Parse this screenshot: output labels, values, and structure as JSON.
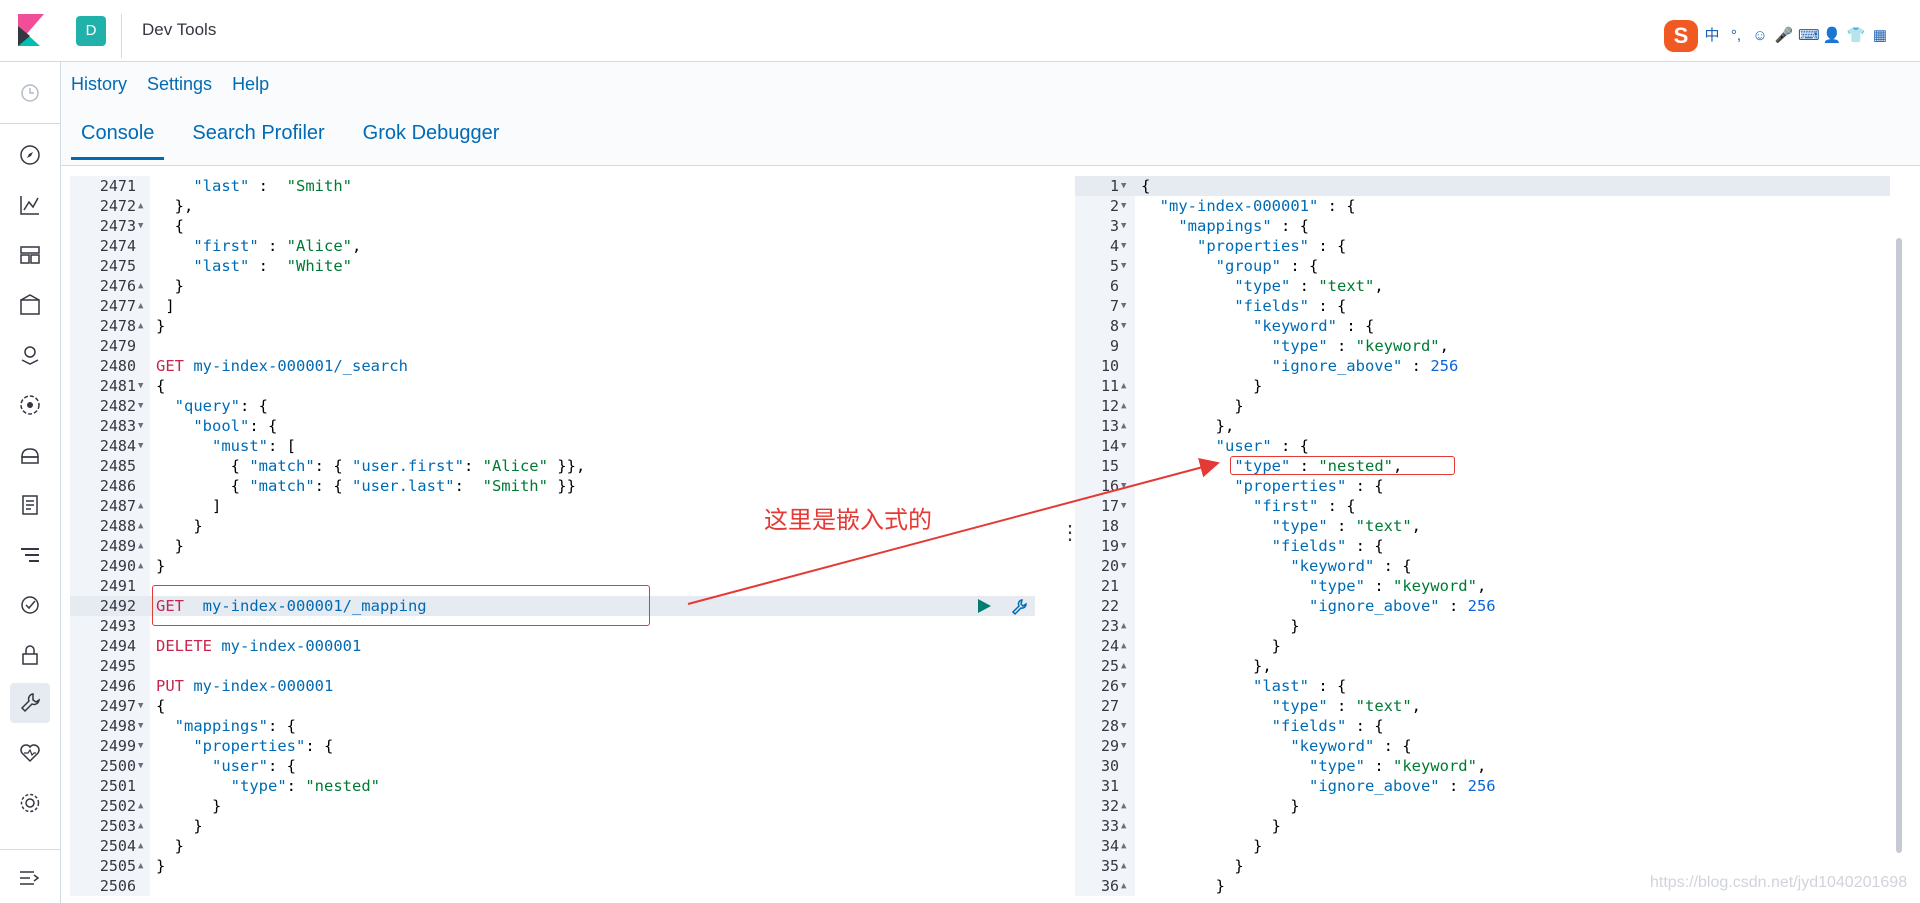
{
  "header": {
    "space_initial": "D",
    "app_title": "Dev Tools"
  },
  "ime_toolbar": [
    "S",
    "中",
    "°,",
    "☺",
    "🎤",
    "⌨",
    "👤",
    "👕",
    "▦"
  ],
  "menu": {
    "links": [
      "History",
      "Settings",
      "Help"
    ]
  },
  "tabs": [
    "Console",
    "Search Profiler",
    "Grok Debugger"
  ],
  "annotation": "这里是嵌入式的",
  "watermark": "https://blog.csdn.net/jyd1040201698",
  "request_lines": [
    {
      "n": "2471",
      "f": "",
      "t": "    \"last\" :  \"Smith\""
    },
    {
      "n": "2472",
      "f": "▲",
      "t": "  },"
    },
    {
      "n": "2473",
      "f": "▼",
      "t": "  {"
    },
    {
      "n": "2474",
      "f": "",
      "t": "    \"first\" : \"Alice\","
    },
    {
      "n": "2475",
      "f": "",
      "t": "    \"last\" :  \"White\""
    },
    {
      "n": "2476",
      "f": "▲",
      "t": "  }"
    },
    {
      "n": "2477",
      "f": "▲",
      "t": " ]"
    },
    {
      "n": "2478",
      "f": "▲",
      "t": "}"
    },
    {
      "n": "2479",
      "f": "",
      "t": ""
    },
    {
      "n": "2480",
      "f": "",
      "t": "GET my-index-000001/_search"
    },
    {
      "n": "2481",
      "f": "▼",
      "t": "{"
    },
    {
      "n": "2482",
      "f": "▼",
      "t": "  \"query\": {"
    },
    {
      "n": "2483",
      "f": "▼",
      "t": "    \"bool\": {"
    },
    {
      "n": "2484",
      "f": "▼",
      "t": "      \"must\": ["
    },
    {
      "n": "2485",
      "f": "",
      "t": "        { \"match\": { \"user.first\": \"Alice\" }},"
    },
    {
      "n": "2486",
      "f": "",
      "t": "        { \"match\": { \"user.last\":  \"Smith\" }}"
    },
    {
      "n": "2487",
      "f": "▲",
      "t": "      ]"
    },
    {
      "n": "2488",
      "f": "▲",
      "t": "    }"
    },
    {
      "n": "2489",
      "f": "▲",
      "t": "  }"
    },
    {
      "n": "2490",
      "f": "▲",
      "t": "}"
    },
    {
      "n": "2491",
      "f": "",
      "t": ""
    },
    {
      "n": "2492",
      "f": "",
      "t": "GET  my-index-000001/_mapping"
    },
    {
      "n": "2493",
      "f": "",
      "t": ""
    },
    {
      "n": "2494",
      "f": "",
      "t": "DELETE my-index-000001"
    },
    {
      "n": "2495",
      "f": "",
      "t": ""
    },
    {
      "n": "2496",
      "f": "",
      "t": "PUT my-index-000001"
    },
    {
      "n": "2497",
      "f": "▼",
      "t": "{"
    },
    {
      "n": "2498",
      "f": "▼",
      "t": "  \"mappings\": {"
    },
    {
      "n": "2499",
      "f": "▼",
      "t": "    \"properties\": {"
    },
    {
      "n": "2500",
      "f": "▼",
      "t": "      \"user\": {"
    },
    {
      "n": "2501",
      "f": "",
      "t": "        \"type\": \"nested\""
    },
    {
      "n": "2502",
      "f": "▲",
      "t": "      }"
    },
    {
      "n": "2503",
      "f": "▲",
      "t": "    }"
    },
    {
      "n": "2504",
      "f": "▲",
      "t": "  }"
    },
    {
      "n": "2505",
      "f": "▲",
      "t": "}"
    },
    {
      "n": "2506",
      "f": "",
      "t": ""
    }
  ],
  "response_lines": [
    {
      "n": "1",
      "f": "▼",
      "t": "{"
    },
    {
      "n": "2",
      "f": "▼",
      "t": "  \"my-index-000001\" : {"
    },
    {
      "n": "3",
      "f": "▼",
      "t": "    \"mappings\" : {"
    },
    {
      "n": "4",
      "f": "▼",
      "t": "      \"properties\" : {"
    },
    {
      "n": "5",
      "f": "▼",
      "t": "        \"group\" : {"
    },
    {
      "n": "6",
      "f": "",
      "t": "          \"type\" : \"text\","
    },
    {
      "n": "7",
      "f": "▼",
      "t": "          \"fields\" : {"
    },
    {
      "n": "8",
      "f": "▼",
      "t": "            \"keyword\" : {"
    },
    {
      "n": "9",
      "f": "",
      "t": "              \"type\" : \"keyword\","
    },
    {
      "n": "10",
      "f": "",
      "t": "              \"ignore_above\" : 256"
    },
    {
      "n": "11",
      "f": "▲",
      "t": "            }"
    },
    {
      "n": "12",
      "f": "▲",
      "t": "          }"
    },
    {
      "n": "13",
      "f": "▲",
      "t": "        },"
    },
    {
      "n": "14",
      "f": "▼",
      "t": "        \"user\" : {"
    },
    {
      "n": "15",
      "f": "",
      "t": "          \"type\" : \"nested\","
    },
    {
      "n": "16",
      "f": "▼",
      "t": "          \"properties\" : {"
    },
    {
      "n": "17",
      "f": "▼",
      "t": "            \"first\" : {"
    },
    {
      "n": "18",
      "f": "",
      "t": "              \"type\" : \"text\","
    },
    {
      "n": "19",
      "f": "▼",
      "t": "              \"fields\" : {"
    },
    {
      "n": "20",
      "f": "▼",
      "t": "                \"keyword\" : {"
    },
    {
      "n": "21",
      "f": "",
      "t": "                  \"type\" : \"keyword\","
    },
    {
      "n": "22",
      "f": "",
      "t": "                  \"ignore_above\" : 256"
    },
    {
      "n": "23",
      "f": "▲",
      "t": "                }"
    },
    {
      "n": "24",
      "f": "▲",
      "t": "              }"
    },
    {
      "n": "25",
      "f": "▲",
      "t": "            },"
    },
    {
      "n": "26",
      "f": "▼",
      "t": "            \"last\" : {"
    },
    {
      "n": "27",
      "f": "",
      "t": "              \"type\" : \"text\","
    },
    {
      "n": "28",
      "f": "▼",
      "t": "              \"fields\" : {"
    },
    {
      "n": "29",
      "f": "▼",
      "t": "                \"keyword\" : {"
    },
    {
      "n": "30",
      "f": "",
      "t": "                  \"type\" : \"keyword\","
    },
    {
      "n": "31",
      "f": "",
      "t": "                  \"ignore_above\" : 256"
    },
    {
      "n": "32",
      "f": "▲",
      "t": "                }"
    },
    {
      "n": "33",
      "f": "▲",
      "t": "              }"
    },
    {
      "n": "34",
      "f": "▲",
      "t": "            }"
    },
    {
      "n": "35",
      "f": "▲",
      "t": "          }"
    },
    {
      "n": "36",
      "f": "▲",
      "t": "        }"
    }
  ]
}
